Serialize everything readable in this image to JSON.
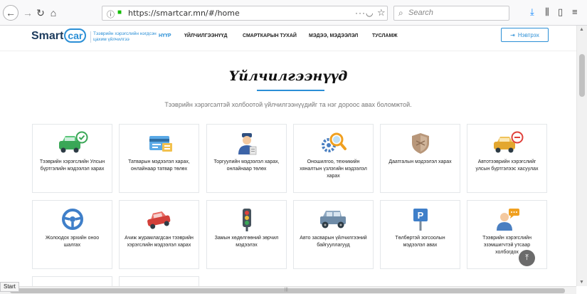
{
  "browser": {
    "url": "https://smartcar.mn/#/home",
    "search_placeholder": "Search",
    "status_text": "Start"
  },
  "site": {
    "logo_text": "Smart",
    "logo_car": "car",
    "tagline": "Тээврийн хэрэгслийн нэгдсэн цахим үйлчилгээ",
    "nav": [
      "НҮҮР",
      "ҮЙЛЧИЛГЭЭНҮҮД",
      "СМАРТКАРЫН ТУХАЙ",
      "МЭДЭЭ, МЭДЭЭЛЭЛ",
      "ТУСЛАМЖ"
    ],
    "login_label": "Нэвтрэх"
  },
  "section": {
    "title": "Үйлчилгээнүүд",
    "subtitle": "Тээврийн хэрэгсэлтэй холбоотой үйлчилгээнүүдийг та нэг дороос авах боломжтой."
  },
  "cards": [
    {
      "label": "Тээврийн хэрэгслийн Улсын бүртгэлийн мэдээлэл харах",
      "icon": "car-check-icon"
    },
    {
      "label": "Татварын мэдээлэл харах, онлайнаар татвар төлөх",
      "icon": "tax-card-icon"
    },
    {
      "label": "Торгуулийн мэдээлэл харах, онлайнаар төлөх",
      "icon": "police-officer-icon"
    },
    {
      "label": "Оношилгоо, техникийн хяналтын үзлэгийн мэдээлэл харах",
      "icon": "inspection-magnifier-icon"
    },
    {
      "label": "Даатгалын мэдээлэл харах",
      "icon": "insurance-shield-icon"
    },
    {
      "label": "Автотээврийн хэрэгслийг улсын бүртгэлээс хасуулах",
      "icon": "car-remove-icon"
    },
    {
      "label": "Жолоодох эрхийн оноо шалгах",
      "icon": "steering-wheel-icon"
    },
    {
      "label": "Ачиж журамлагдсан тээврийн хэрэгслийн мэдээлэл харах",
      "icon": "towed-car-icon"
    },
    {
      "label": "Замын хөдөлгөөний зөрчил мэдээлэх",
      "icon": "traffic-light-icon"
    },
    {
      "label": "Авто засварын үйлчилгээний байгууллагууд",
      "icon": "jeep-repair-icon"
    },
    {
      "label": "Төлбөртэй зогсоолын мэдээлэл авах",
      "icon": "parking-sign-icon"
    },
    {
      "label": "Тээврийн хэрэгслийн эзэмшигчтэй утсаар холбогдох",
      "icon": "owner-chat-icon"
    }
  ]
}
